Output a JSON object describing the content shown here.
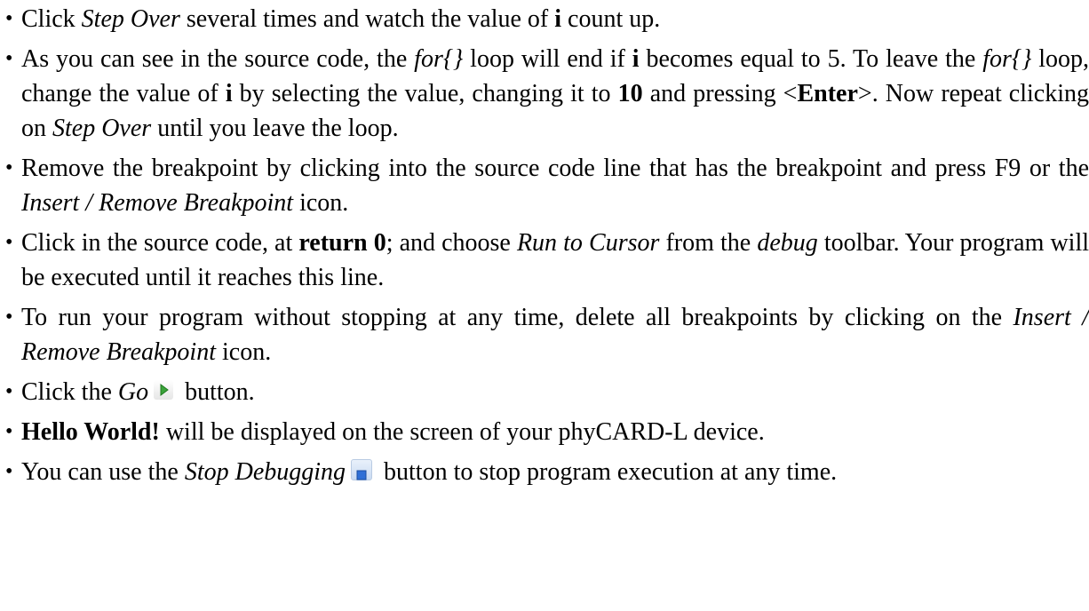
{
  "bullet_char": "•",
  "items": [
    {
      "p1": "Click ",
      "e1": "Step Over",
      "p2": " several times and watch the value of ",
      "b1": "i",
      "p3": " count up."
    },
    {
      "p1": "As you can see in the source code, the ",
      "e1": "for{}",
      "p2": " loop will end if ",
      "b1": "i",
      "p3": " becomes equal to 5. To leave the ",
      "e2": "for{}",
      "p4": " loop, change the value of ",
      "b2": "i",
      "p5": " by selecting the value, changing it to ",
      "b3": "10",
      "p6": " and pressing <",
      "b4": "Enter",
      "p7": ">. Now repeat clicking on ",
      "e3": "Step Over",
      "p8": " until you leave the loop."
    },
    {
      "p1": "Remove the breakpoint by clicking into the source code line that has the breakpoint and press F9 or the ",
      "e1": "Insert / Remove Breakpoint",
      "p2": " icon."
    },
    {
      "p1": "Click in the source code, at ",
      "b1": "return 0",
      "p2": "; and choose ",
      "e1": "Run to Cursor",
      "p3": " from the ",
      "e2": "debug",
      "p4": " toolbar. Your program will be executed until it reaches this line."
    },
    {
      "p1": "To run your program without stopping at any time, delete all breakpoints by clicking on the ",
      "e1": "Insert / Remove Breakpoint",
      "p2": " icon."
    },
    {
      "p1": "Click the ",
      "e1": "Go",
      "icon": "go-icon",
      "p2": " button."
    },
    {
      "b1": "Hello World!",
      "p1": " will be displayed on the screen of your phyCARD-L device."
    },
    {
      "p1": "You can use the ",
      "e1": "Stop Debugging",
      "icon": "stop-debugging-icon",
      "p2": " button to stop program execution at any time."
    }
  ]
}
